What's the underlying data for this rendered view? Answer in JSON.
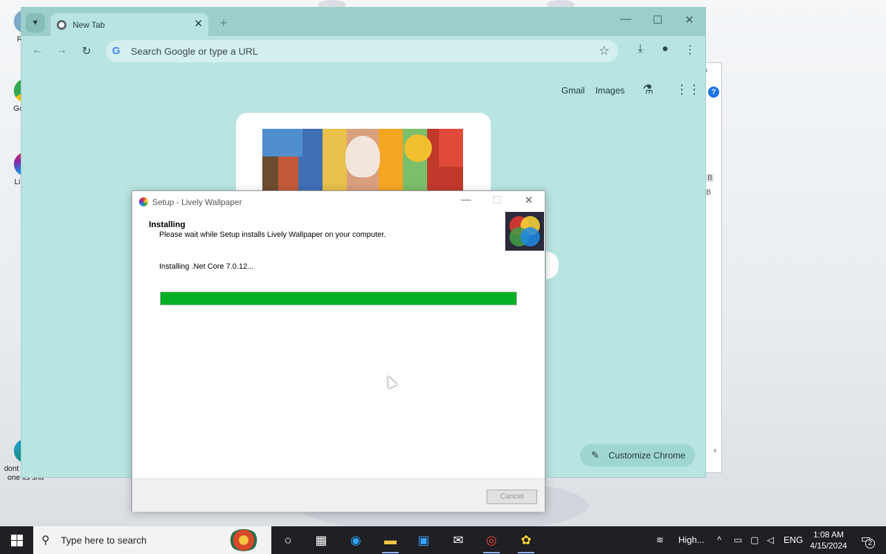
{
  "desktop": {
    "icons": [
      {
        "label": "Recy"
      },
      {
        "label": "Go Chr"
      },
      {
        "label": "Li Wall"
      },
      {
        "label": "dont use this one its shit"
      }
    ]
  },
  "chrome": {
    "tab_title": "New Tab",
    "omnibox_placeholder": "Search Google or type a URL",
    "links": {
      "gmail": "Gmail",
      "images": "Images"
    },
    "customize_label": "Customize Chrome",
    "theme_color": "#b8e4e2"
  },
  "background_window": {
    "b1": "B",
    "b2": "B",
    "help": "?"
  },
  "setup": {
    "title": "Setup - Lively Wallpaper",
    "heading": "Installing",
    "subheading": "Please wait while Setup installs Lively Wallpaper on your computer.",
    "status": "Installing .Net Core 7.0.12...",
    "progress": 1.0,
    "progress_color": "#06b025",
    "cancel_label": "Cancel"
  },
  "taskbar": {
    "search_placeholder": "Type here to search",
    "weather": "High...",
    "language": "ENG",
    "time": "1:08 AM",
    "date": "4/15/2024",
    "notification_count": "2"
  }
}
